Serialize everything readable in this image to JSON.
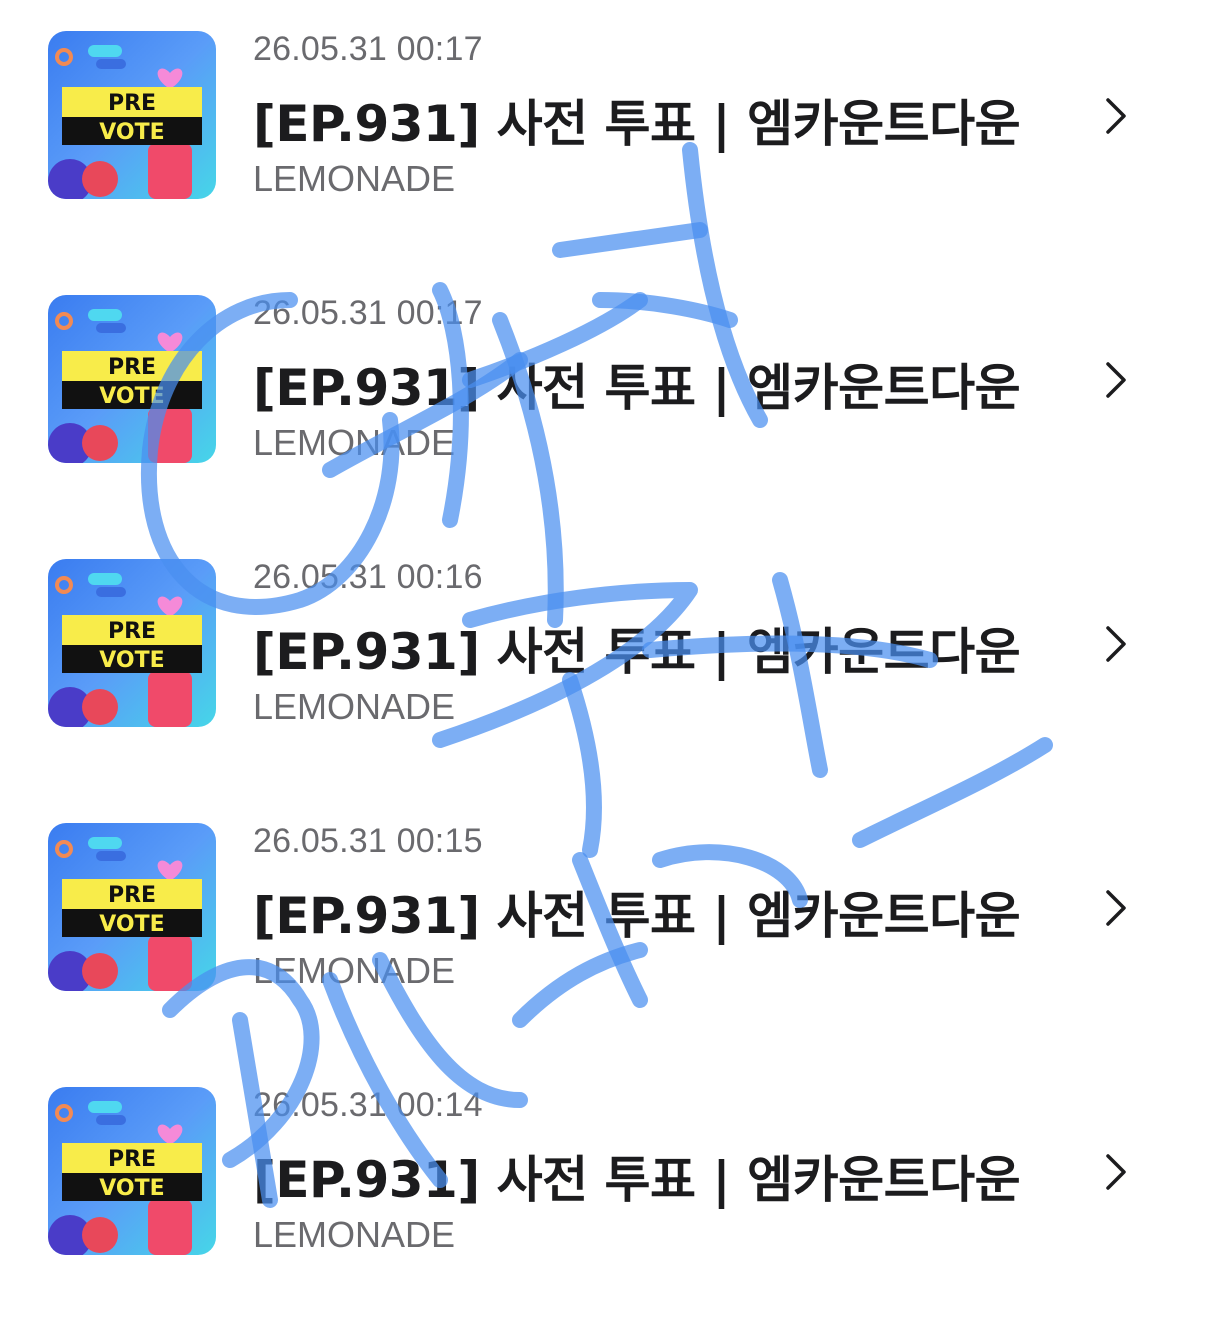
{
  "items": [
    {
      "date": "26.05.31 00:17",
      "title": "[EP.931] 사전 투표 | 엠카운트다운",
      "artist": "LEMONADE",
      "thumb_top": "PRE",
      "thumb_bottom": "VOTE"
    },
    {
      "date": "26.05.31 00:17",
      "title": "[EP.931] 사전 투표 | 엠카운트다운",
      "artist": "LEMONADE",
      "thumb_top": "PRE",
      "thumb_bottom": "VOTE"
    },
    {
      "date": "26.05.31 00:16",
      "title": "[EP.931] 사전 투표 | 엠카운트다운",
      "artist": "LEMONADE",
      "thumb_top": "PRE",
      "thumb_bottom": "VOTE"
    },
    {
      "date": "26.05.31 00:15",
      "title": "[EP.931] 사전 투표 | 엠카운트다운",
      "artist": "LEMONADE",
      "thumb_top": "PRE",
      "thumb_bottom": "VOTE"
    },
    {
      "date": "26.05.31 00:14",
      "title": "[EP.931] 사전 투표 | 엠카운트다운",
      "artist": "LEMONADE",
      "thumb_top": "PRE",
      "thumb_bottom": "VOTE"
    }
  ],
  "icons": {
    "chevron": "chevron-right-icon",
    "thumbnail": "prevote-thumbnail-icon"
  },
  "colors": {
    "title": "#1c1c1e",
    "secondary": "#6a6a6e",
    "handwriting": "#4a8ff0"
  }
}
